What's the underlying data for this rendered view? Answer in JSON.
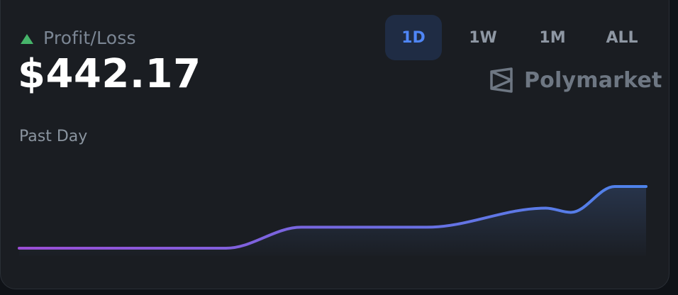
{
  "header": {
    "title": "Profit/Loss",
    "trend_icon": "up-triangle-icon",
    "trend_color": "#46b46a"
  },
  "summary": {
    "amount": "$442.17",
    "period_label": "Past Day"
  },
  "timeframes": {
    "selected": "1D",
    "options": [
      "1D",
      "1W",
      "1M",
      "ALL"
    ]
  },
  "brand": {
    "name": "Polymarket",
    "icon": "polymarket-logo-icon"
  },
  "chart_data": {
    "type": "area",
    "x": [
      0,
      11,
      33,
      45,
      53,
      65,
      84,
      88,
      95,
      100
    ],
    "series": [
      {
        "values": [
          0.0,
          0.0,
          0.0,
          0.34,
          0.34,
          0.34,
          0.65,
          0.58,
          1.0,
          1.0
        ]
      }
    ],
    "xlabel": "",
    "ylabel": "",
    "grid": false,
    "legend": "none",
    "colors": {
      "line_start": "#9b4ed6",
      "line_end": "#4d83ea",
      "fill": "#2d3d5b"
    }
  }
}
